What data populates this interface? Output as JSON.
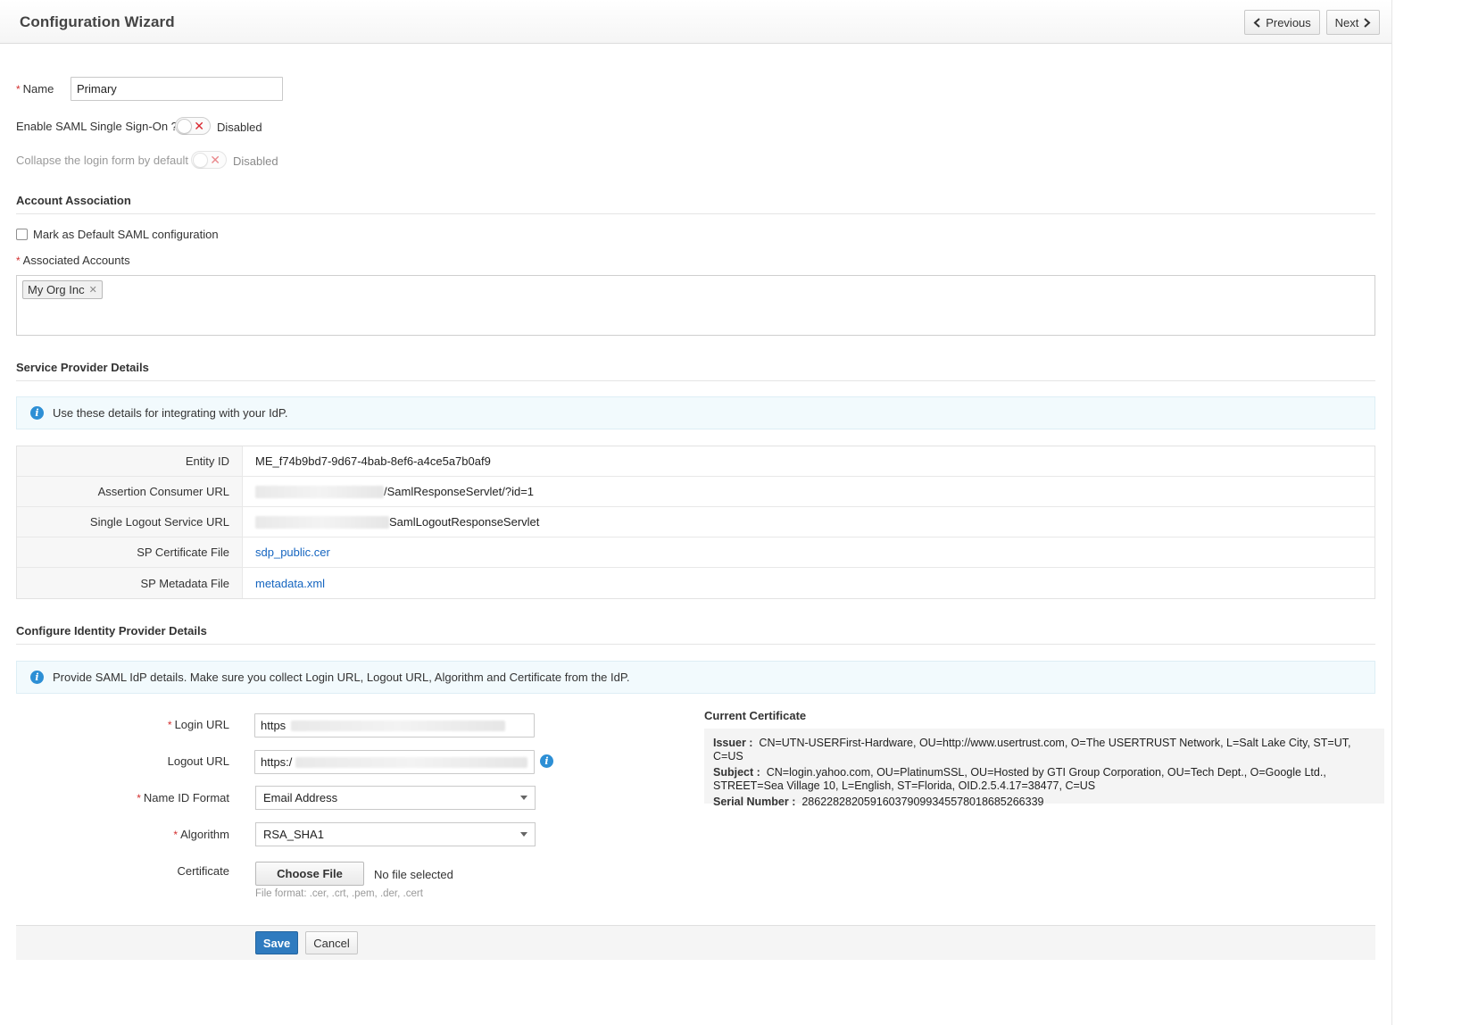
{
  "header": {
    "title": "Configuration Wizard",
    "previous_label": "Previous",
    "next_label": "Next"
  },
  "general": {
    "name_label": "Name",
    "name_value": "Primary",
    "enable_sso_label": "Enable SAML Single Sign-On ?",
    "enable_sso_state": "Disabled",
    "collapse_label": "Collapse the login form by default",
    "collapse_state": "Disabled"
  },
  "account_association": {
    "title": "Account Association",
    "default_checkbox_label": "Mark as Default SAML configuration",
    "associated_label": "Associated Accounts",
    "tags": [
      "My Org Inc"
    ]
  },
  "service_provider": {
    "title": "Service Provider Details",
    "info": "Use these details for integrating with your IdP.",
    "rows": [
      {
        "key": "Entity ID",
        "value": "ME_f74b9bd7-9d67-4bab-8ef6-a4ce5a7b0af9"
      },
      {
        "key": "Assertion Consumer URL",
        "value": "/SamlResponseServlet/?id=1"
      },
      {
        "key": "Single Logout Service URL",
        "value": "SamlLogoutResponseServlet"
      },
      {
        "key": "SP Certificate File",
        "value": "sdp_public.cer"
      },
      {
        "key": "SP Metadata File",
        "value": "metadata.xml"
      }
    ]
  },
  "identity_provider": {
    "title": "Configure Identity Provider Details",
    "info": "Provide SAML IdP details. Make sure you collect Login URL, Logout URL, Algorithm and Certificate from the IdP.",
    "login_url_label": "Login URL",
    "login_url_value": "https",
    "logout_url_label": "Logout URL",
    "logout_url_value": "https:/",
    "name_id_label": "Name ID Format",
    "name_id_value": "Email Address",
    "algorithm_label": "Algorithm",
    "algorithm_value": "RSA_SHA1",
    "certificate_label": "Certificate",
    "choose_file_label": "Choose File",
    "no_file_text": "No file selected",
    "file_format_hint": "File format: .cer, .crt, .pem, .der, .cert"
  },
  "current_certificate": {
    "title": "Current Certificate",
    "issuer_label": "Issuer :",
    "issuer_value": "CN=UTN-USERFirst-Hardware, OU=http://www.usertrust.com, O=The USERTRUST Network, L=Salt Lake City, ST=UT, C=US",
    "subject_label": "Subject :",
    "subject_value": "CN=login.yahoo.com, OU=PlatinumSSL, OU=Hosted by GTI Group Corporation, OU=Tech Dept., O=Google Ltd., STREET=Sea Village 10, L=English, ST=Florida, OID.2.5.4.17=38477, C=US",
    "serial_label": "Serial Number :",
    "serial_value": "286228282059160379099345578018685266339"
  },
  "footer": {
    "save_label": "Save",
    "cancel_label": "Cancel"
  },
  "colors": {
    "accent": "#2f7bbf",
    "link": "#1565c0",
    "required": "#d32f2f",
    "toggle_off": "#d9262e",
    "info_bg": "#f2fafd"
  }
}
